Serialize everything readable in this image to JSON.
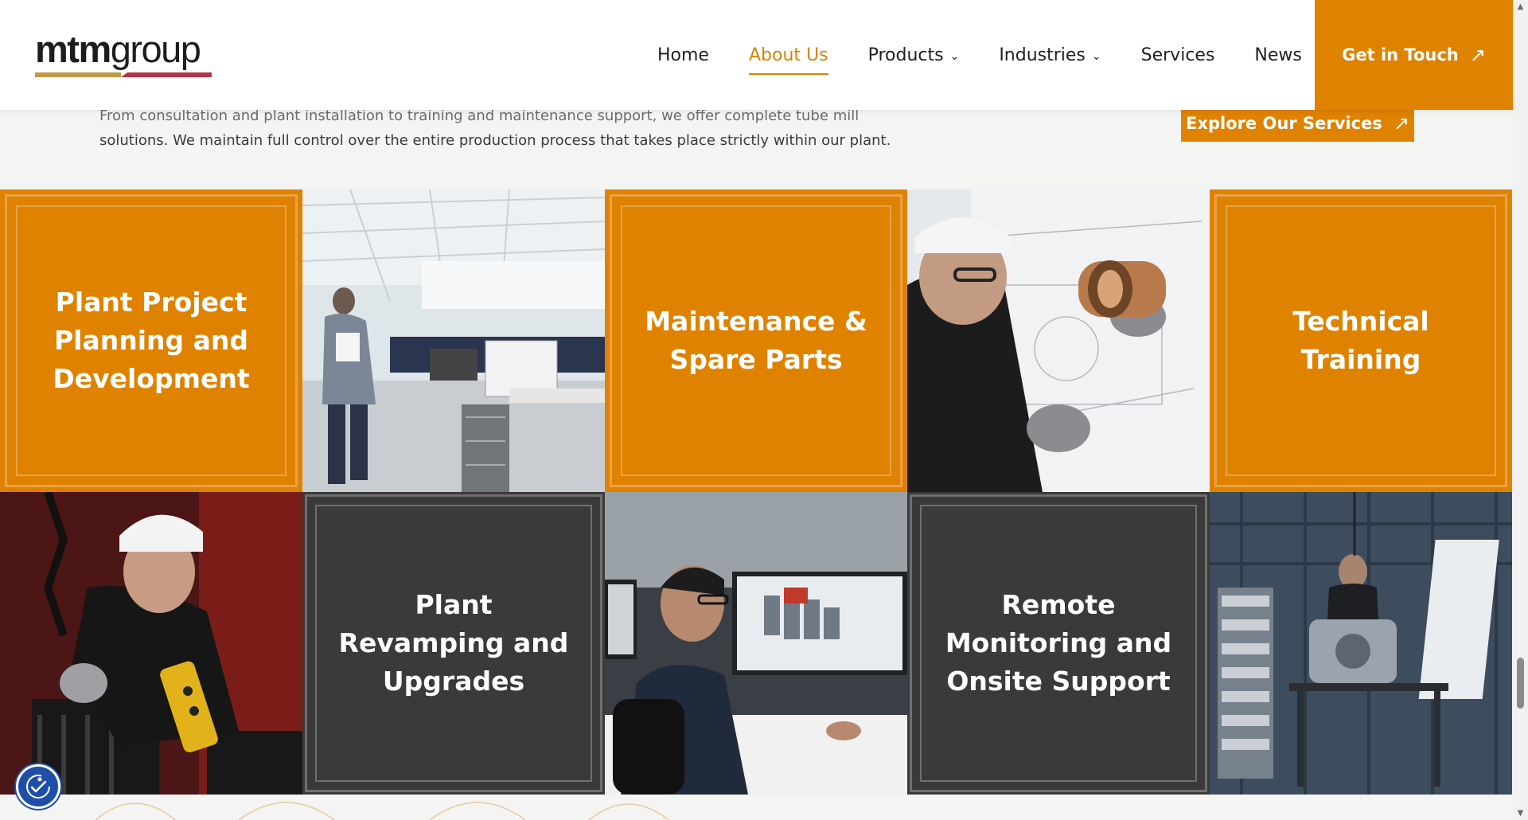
{
  "header": {
    "logo": {
      "bold": "mtm",
      "light": "group"
    },
    "nav": [
      {
        "label": "Home",
        "active": false,
        "dropdown": false
      },
      {
        "label": "About Us",
        "active": true,
        "dropdown": false
      },
      {
        "label": "Products",
        "active": false,
        "dropdown": true
      },
      {
        "label": "Industries",
        "active": false,
        "dropdown": true
      },
      {
        "label": "Services",
        "active": false,
        "dropdown": false
      },
      {
        "label": "News",
        "active": false,
        "dropdown": false
      }
    ],
    "cta_label": "Get in Touch"
  },
  "intro": {
    "clipped_line": "From consultation and plant installation to training and maintenance support, we offer complete tube mill",
    "line": "solutions. We maintain full control over the entire production process that takes place strictly within our plant.",
    "explore_label": "Explore Our Services"
  },
  "tiles": {
    "planning": "Plant Project Planning and Development",
    "maintenance": "Maintenance & Spare Parts",
    "training": "Technical Training",
    "revamping": "Plant Revamping and Upgrades",
    "remote": "Remote Monitoring and Onsite Support"
  },
  "colors": {
    "accent": "#df8200",
    "dark_tile": "#3a3a3a",
    "logo_gold": "#c19a48",
    "logo_red": "#b3344a",
    "a11y_blue": "#1f4ea8"
  },
  "icons": {
    "cta": "arrow-up-right-icon",
    "dropdown": "chevron-down-icon",
    "accessibility": "accessibility-icon"
  }
}
